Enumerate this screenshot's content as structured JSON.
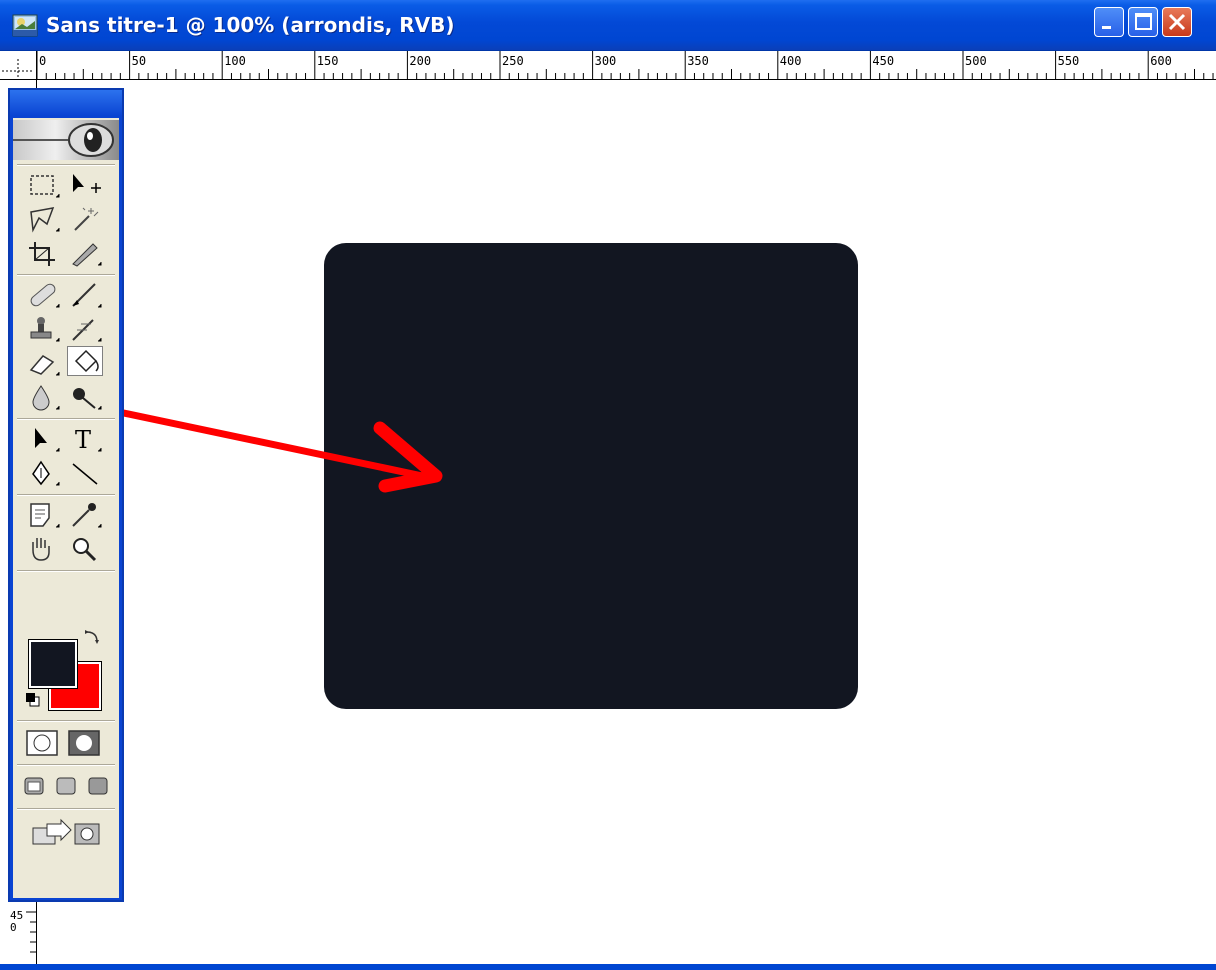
{
  "window": {
    "title": "Sans titre-1 @ 100% (arrondis, RVB)"
  },
  "ruler": {
    "top_labels": [
      "0",
      "50",
      "100",
      "150",
      "200",
      "250",
      "300",
      "350",
      "400",
      "450",
      "500",
      "550",
      "600"
    ],
    "left_label": "450"
  },
  "toolbox": {
    "selected_tool": "paint-bucket-icon",
    "foreground_color": "#121621",
    "background_color": "#ff0000"
  },
  "canvas": {
    "shape_color": "#121621",
    "arrow_color": "#ff0000"
  }
}
